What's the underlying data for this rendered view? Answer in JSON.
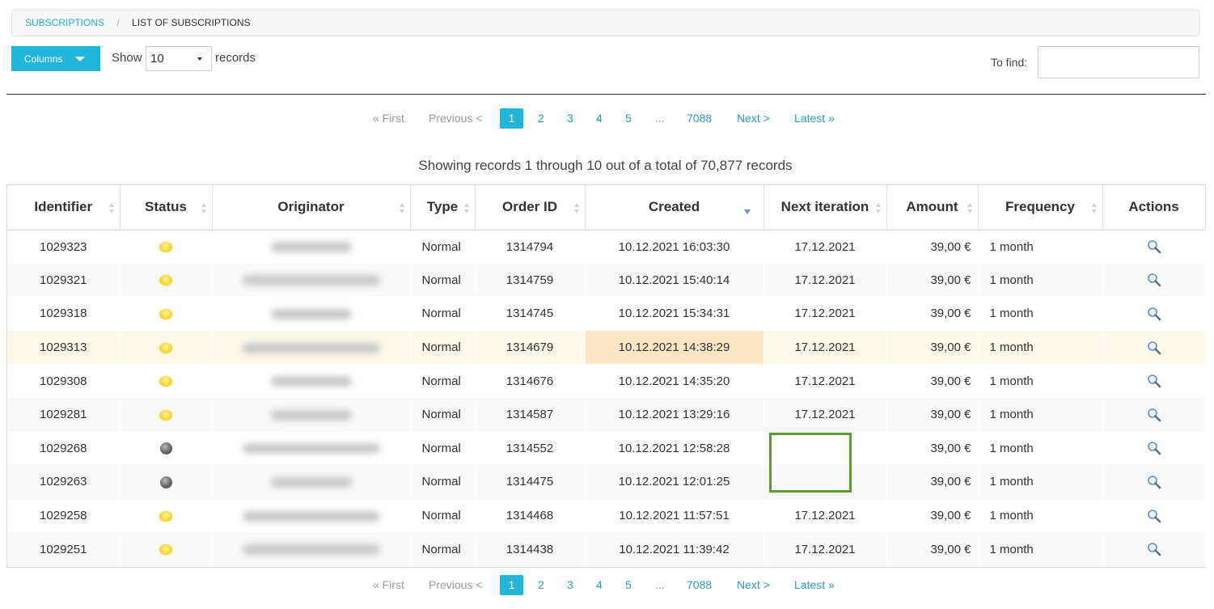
{
  "breadcrumb": {
    "parent": "Subscriptions",
    "separator": "/",
    "current": "List of subscriptions"
  },
  "toolbar": {
    "columns_label": "Columns",
    "show_label": "Show",
    "page_size": "10",
    "records_label": "records",
    "find_label": "To find:",
    "find_value": ""
  },
  "pagination": {
    "first": "« First",
    "previous": "Previous <",
    "pages": [
      "1",
      "2",
      "3",
      "4",
      "5"
    ],
    "ellipsis": "...",
    "last_page": "7088",
    "next": "Next >",
    "latest": "Latest »",
    "current_page": "1"
  },
  "summary": "Showing records 1 through 10 out of a total of 70,877 records",
  "table": {
    "columns": [
      "Identifier",
      "Status",
      "Originator",
      "Type",
      "Order ID",
      "Created",
      "Next iteration",
      "Amount",
      "Frequency",
      "Actions"
    ],
    "sorted_column": "Created",
    "sort_direction": "desc",
    "rows": [
      {
        "id": "1029323",
        "status": "sun-icon",
        "type": "Normal",
        "order_id": "1314794",
        "created": "10.12.2021 16:03:30",
        "next": "17.12.2021",
        "amount": "39,00 €",
        "frequency": "1 month"
      },
      {
        "id": "1029321",
        "status": "sun-icon",
        "type": "Normal",
        "order_id": "1314759",
        "created": "10.12.2021 15:40:14",
        "next": "17.12.2021",
        "amount": "39,00 €",
        "frequency": "1 month"
      },
      {
        "id": "1029318",
        "status": "sun-icon",
        "type": "Normal",
        "order_id": "1314745",
        "created": "10.12.2021 15:34:31",
        "next": "17.12.2021",
        "amount": "39,00 €",
        "frequency": "1 month"
      },
      {
        "id": "1029313",
        "status": "sun-icon",
        "type": "Normal",
        "order_id": "1314679",
        "created": "10.12.2021 14:38:29",
        "next": "17.12.2021",
        "amount": "39,00 €",
        "frequency": "1 month"
      },
      {
        "id": "1029308",
        "status": "sun-icon",
        "type": "Normal",
        "order_id": "1314676",
        "created": "10.12.2021 14:35:20",
        "next": "17.12.2021",
        "amount": "39,00 €",
        "frequency": "1 month"
      },
      {
        "id": "1029281",
        "status": "sun-icon",
        "type": "Normal",
        "order_id": "1314587",
        "created": "10.12.2021 13:29:16",
        "next": "17.12.2021",
        "amount": "39,00 €",
        "frequency": "1 month"
      },
      {
        "id": "1029268",
        "status": "moon-icon",
        "type": "Normal",
        "order_id": "1314552",
        "created": "10.12.2021 12:58:28",
        "next": "",
        "amount": "39,00 €",
        "frequency": "1 month"
      },
      {
        "id": "1029263",
        "status": "moon-icon",
        "type": "Normal",
        "order_id": "1314475",
        "created": "10.12.2021 12:01:25",
        "next": "",
        "amount": "39,00 €",
        "frequency": "1 month"
      },
      {
        "id": "1029258",
        "status": "sun-icon",
        "type": "Normal",
        "order_id": "1314468",
        "created": "10.12.2021 11:57:51",
        "next": "17.12.2021",
        "amount": "39,00 €",
        "frequency": "1 month"
      },
      {
        "id": "1029251",
        "status": "sun-icon",
        "type": "Normal",
        "order_id": "1314438",
        "created": "10.12.2021 11:39:42",
        "next": "17.12.2021",
        "amount": "39,00 €",
        "frequency": "1 month"
      }
    ]
  },
  "colors": {
    "accent": "#22b5dc",
    "link": "#2a9bc3",
    "highlight_row": "#fdf9e8",
    "highlight_cell": "#fce6c4",
    "annotation_box": "#5c9e31"
  }
}
